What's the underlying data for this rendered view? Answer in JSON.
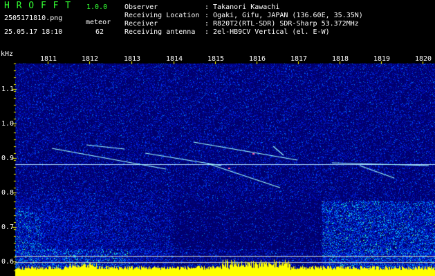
{
  "app": {
    "logo": "H R O F F T",
    "version": "1.0.0",
    "filename": "2505171810.png",
    "datetime": "25.05.17 18:10",
    "mode_label": "meteor",
    "count": "62"
  },
  "info": {
    "labels": [
      "Observer",
      "Receiving Location",
      "Receiver",
      "Receiving antenna"
    ],
    "values": [
      ": Takanori Kawachi",
      ": Ogaki, Gifu, JAPAN (136.60E, 35.35N)",
      ": R820T2(RTL-SDR) SDR-Sharp 53.372MHz",
      ": 2el-HB9CV Vertical (el. E-W)"
    ]
  },
  "axes": {
    "unit": "kHz",
    "y_ticks": [
      "1.1",
      "1.0",
      "0.9",
      "0.8",
      "0.7",
      "0.6"
    ],
    "x_ticks": [
      "1811",
      "1812",
      "1813",
      "1814",
      "1815",
      "1816",
      "1817",
      "1818",
      "1819",
      "1820"
    ]
  },
  "colors": {
    "logo": "#33ff33",
    "tick": "#ffff00",
    "background": "#000080",
    "carrier": "#b0e0ff"
  }
}
